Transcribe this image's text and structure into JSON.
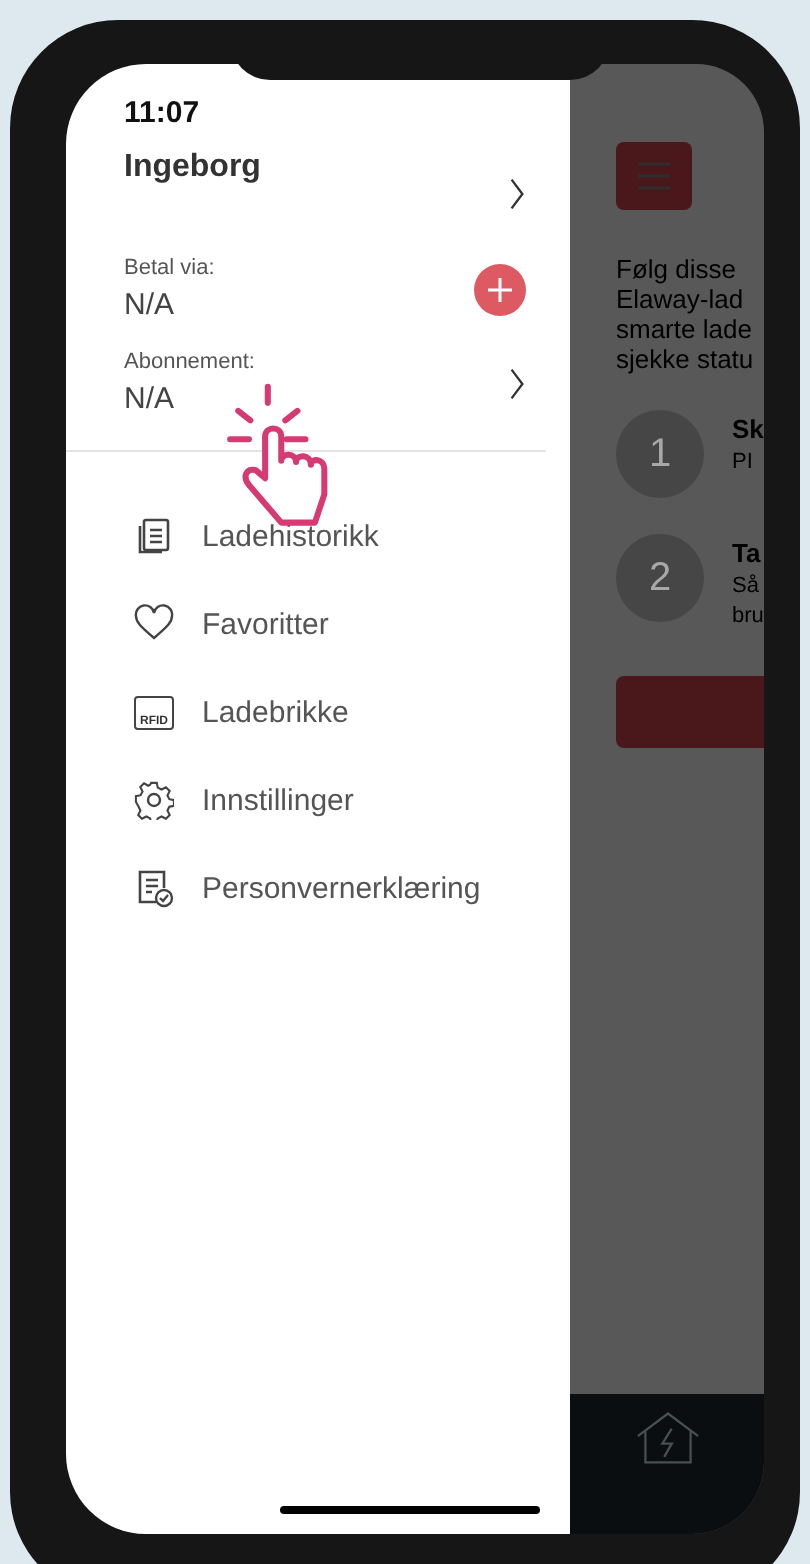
{
  "status_bar": {
    "time": "11:07"
  },
  "drawer": {
    "user_name": "Ingeborg",
    "payment": {
      "label": "Betal via:",
      "value": "N/A"
    },
    "subscription": {
      "label": "Abonnement:",
      "value": "N/A"
    },
    "menu": [
      {
        "kind": "history",
        "label": "Ladehistorikk"
      },
      {
        "kind": "favorites",
        "label": "Favoritter"
      },
      {
        "kind": "rfid",
        "label": "Ladebrikke",
        "icon_text": "RFID"
      },
      {
        "kind": "settings",
        "label": "Innstillinger"
      },
      {
        "kind": "privacy",
        "label": "Personvernerklæring"
      }
    ]
  },
  "background_screen": {
    "intro_lines": [
      "Følg disse",
      "Elaway-lad",
      "smarte lade",
      "sjekke statu"
    ],
    "steps": [
      {
        "number": "1",
        "title": "Sk",
        "text_lines": [
          "PI"
        ]
      },
      {
        "number": "2",
        "title": "Ta",
        "text_lines": [
          "Så",
          "bru"
        ]
      }
    ]
  }
}
